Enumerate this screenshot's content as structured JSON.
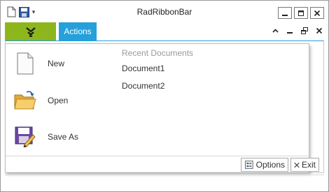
{
  "window": {
    "title": "RadRibbonBar"
  },
  "quick_access": {
    "items": [
      {
        "icon": "new-document-icon"
      },
      {
        "icon": "save-icon"
      }
    ],
    "dropdown_icon": "quick-access-dropdown-icon"
  },
  "window_controls": {
    "minimize_icon": "minimize-icon",
    "maximize_icon": "maximize-icon",
    "close_icon": "close-icon"
  },
  "ribbon": {
    "application_button_icon": "application-menu-icon",
    "tabs": [
      {
        "label": "Actions"
      }
    ],
    "controls": {
      "collapse_icon": "chevron-up-icon",
      "minimize_icon": "minimize-icon",
      "restore_icon": "restore-icon",
      "close_icon": "close-icon"
    },
    "accent_color": "#25a0da",
    "app_button_color": "#8db61c"
  },
  "app_menu": {
    "items": [
      {
        "label": "New",
        "icon": "new-document-icon"
      },
      {
        "label": "Open",
        "icon": "open-folder-icon"
      },
      {
        "label": "Save As",
        "icon": "save-as-icon"
      }
    ],
    "recent": {
      "title": "Recent Documents",
      "documents": [
        "Document1",
        "Document2"
      ]
    },
    "footer": {
      "options_label": "Options",
      "exit_label": "Exit"
    }
  }
}
